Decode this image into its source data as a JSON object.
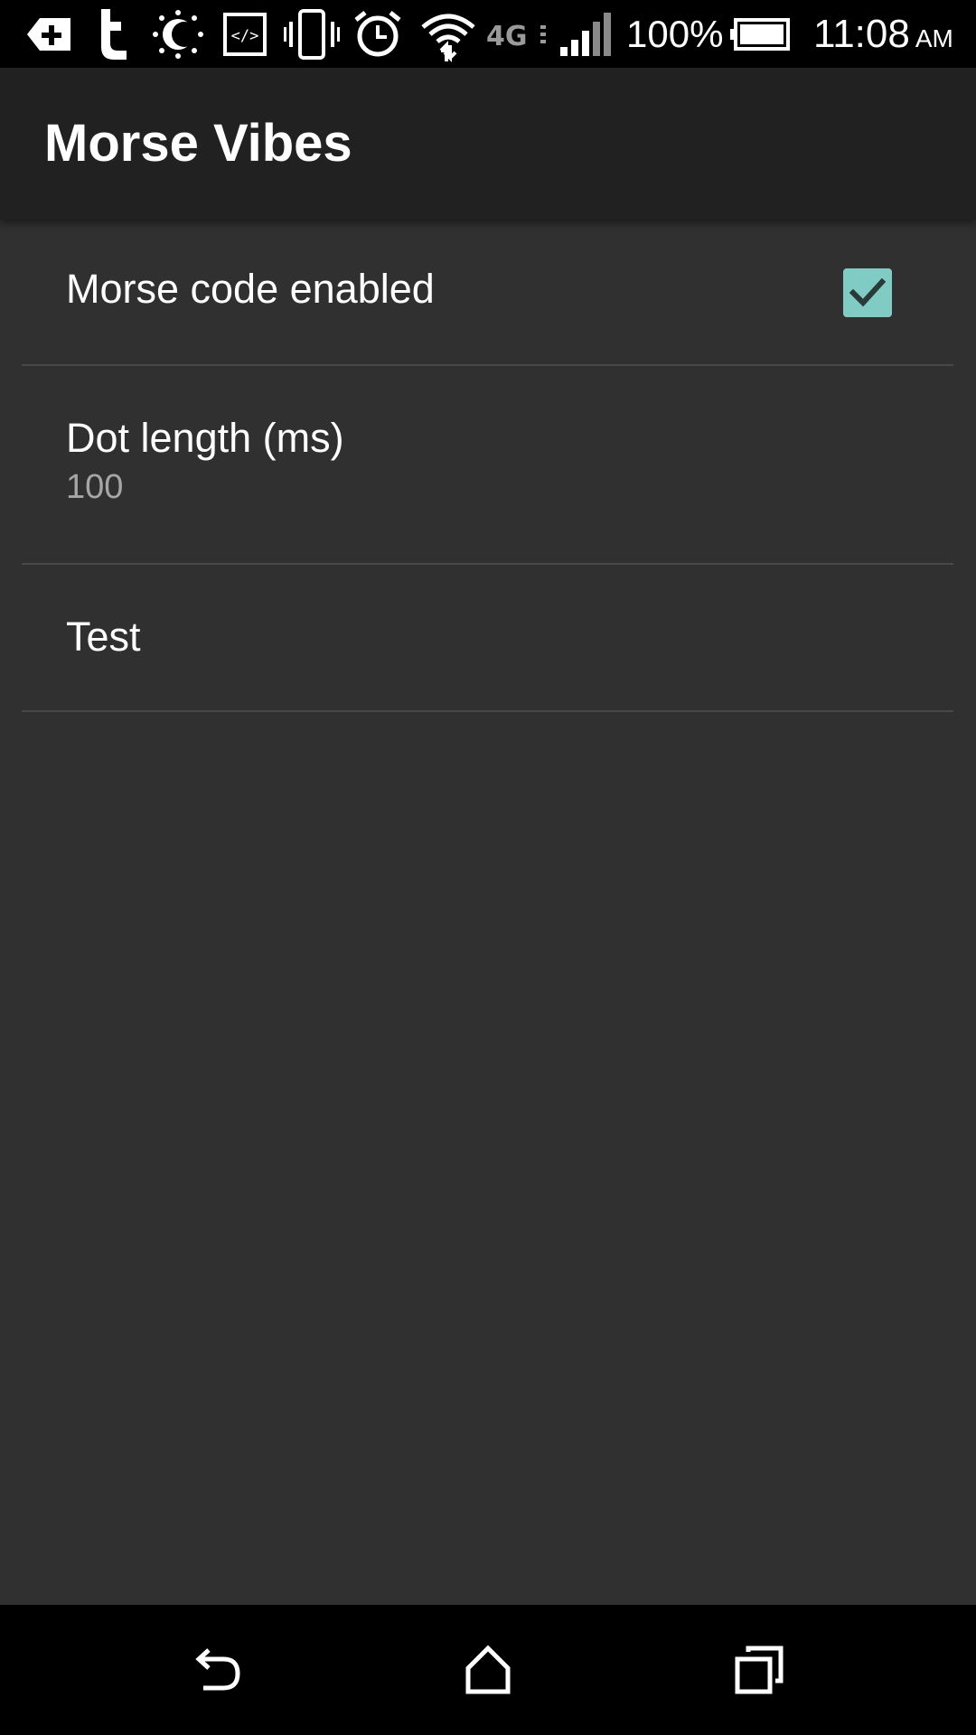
{
  "status_bar": {
    "icons": [
      "plus-app-icon",
      "tumblr-icon",
      "brightness-icon",
      "code-icon",
      "vibrate-icon",
      "alarm-icon",
      "wifi-icon",
      "4g-lte-icon",
      "signal-icon",
      "battery-icon"
    ],
    "network_label": "4G",
    "battery_percent": "100%",
    "time": "11:08",
    "ampm": "AM"
  },
  "app_bar": {
    "title": "Morse Vibes"
  },
  "preferences": [
    {
      "title": "Morse code enabled",
      "checked": true
    },
    {
      "title": "Dot length (ms)",
      "summary": "100"
    },
    {
      "title": "Test"
    }
  ],
  "nav_bar": {
    "buttons": [
      "back-icon",
      "home-icon",
      "recents-icon"
    ]
  },
  "colors": {
    "background": "#303030",
    "app_bar": "#212121",
    "accent": "#80cbc4",
    "divider": "#484848",
    "summary_text": "#a6a6a6"
  }
}
